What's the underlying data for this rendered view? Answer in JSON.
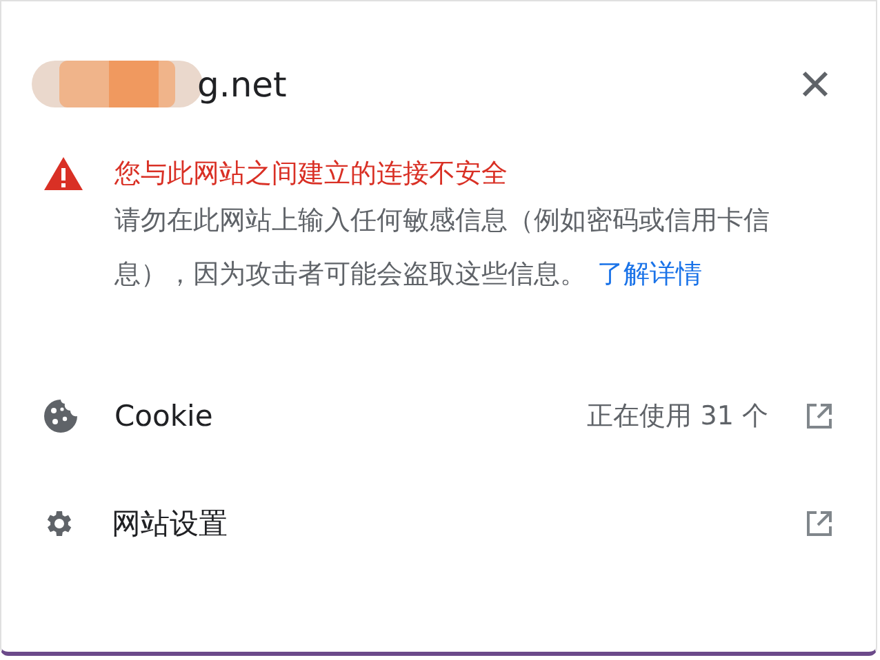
{
  "site": {
    "domain": "g.net"
  },
  "warning": {
    "title": "您与此网站之间建立的连接不安全",
    "body": "请勿在此网站上输入任何敏感信息（例如密码或信用卡信息），因为攻击者可能会盗取这些信息。",
    "link": "了解详情"
  },
  "rows": [
    {
      "kind": "cookie",
      "label": "Cookie",
      "detail": "正在使用 31 个"
    },
    {
      "kind": "settings",
      "label": "网站设置"
    }
  ]
}
